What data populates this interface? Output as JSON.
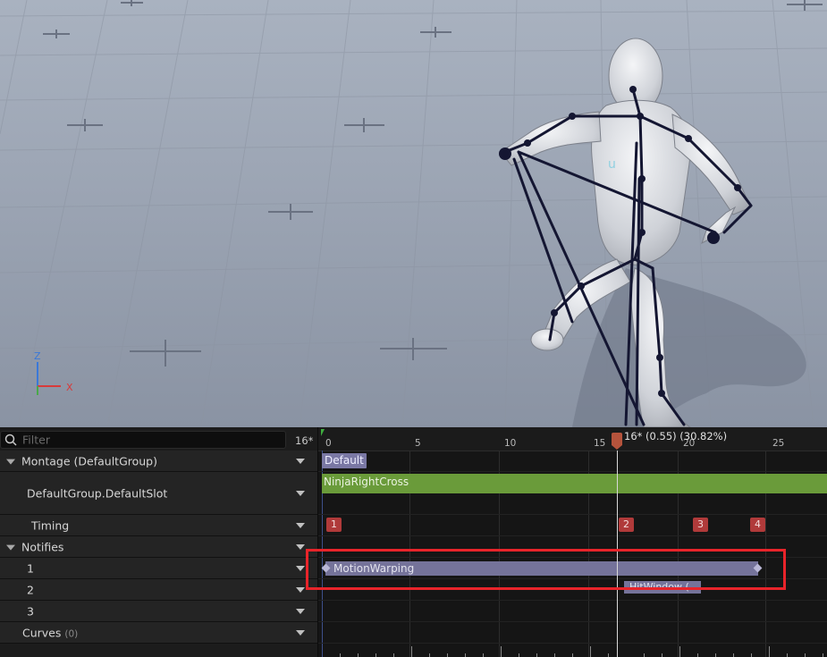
{
  "viewport": {
    "axis_z": "Z",
    "axis_x": "X",
    "skeleton_label": "u"
  },
  "timeline": {
    "filter_placeholder": "Filter",
    "frame_count": "16*",
    "ruler_ticks": [
      "0",
      "5",
      "10",
      "15",
      "20",
      "25"
    ],
    "playhead_label": "16* (0.55) (30.82%)",
    "playhead_frame": 16
  },
  "tracks": {
    "montage_label": "Montage (DefaultGroup)",
    "slot_label": "DefaultGroup.DefaultSlot",
    "timing_label": "Timing",
    "notifies_label": "Notifies",
    "notify_rows": [
      "1",
      "2",
      "3"
    ],
    "curves_label": "Curves",
    "curves_count": "(0)"
  },
  "lanes": {
    "section_label": "Default",
    "clip_label": "NinjaRightCross",
    "timing_markers": [
      "1",
      "2",
      "3",
      "4"
    ],
    "motion_warping_label": "MotionWarping",
    "hit_window_label": "HitWindow ("
  },
  "colors": {
    "clip_green": "#6a9b3a",
    "notify_bar": "#75739a",
    "marker_red": "#b03a3a",
    "highlight_red": "#e8242a",
    "section_purple": "#7a78a4"
  }
}
